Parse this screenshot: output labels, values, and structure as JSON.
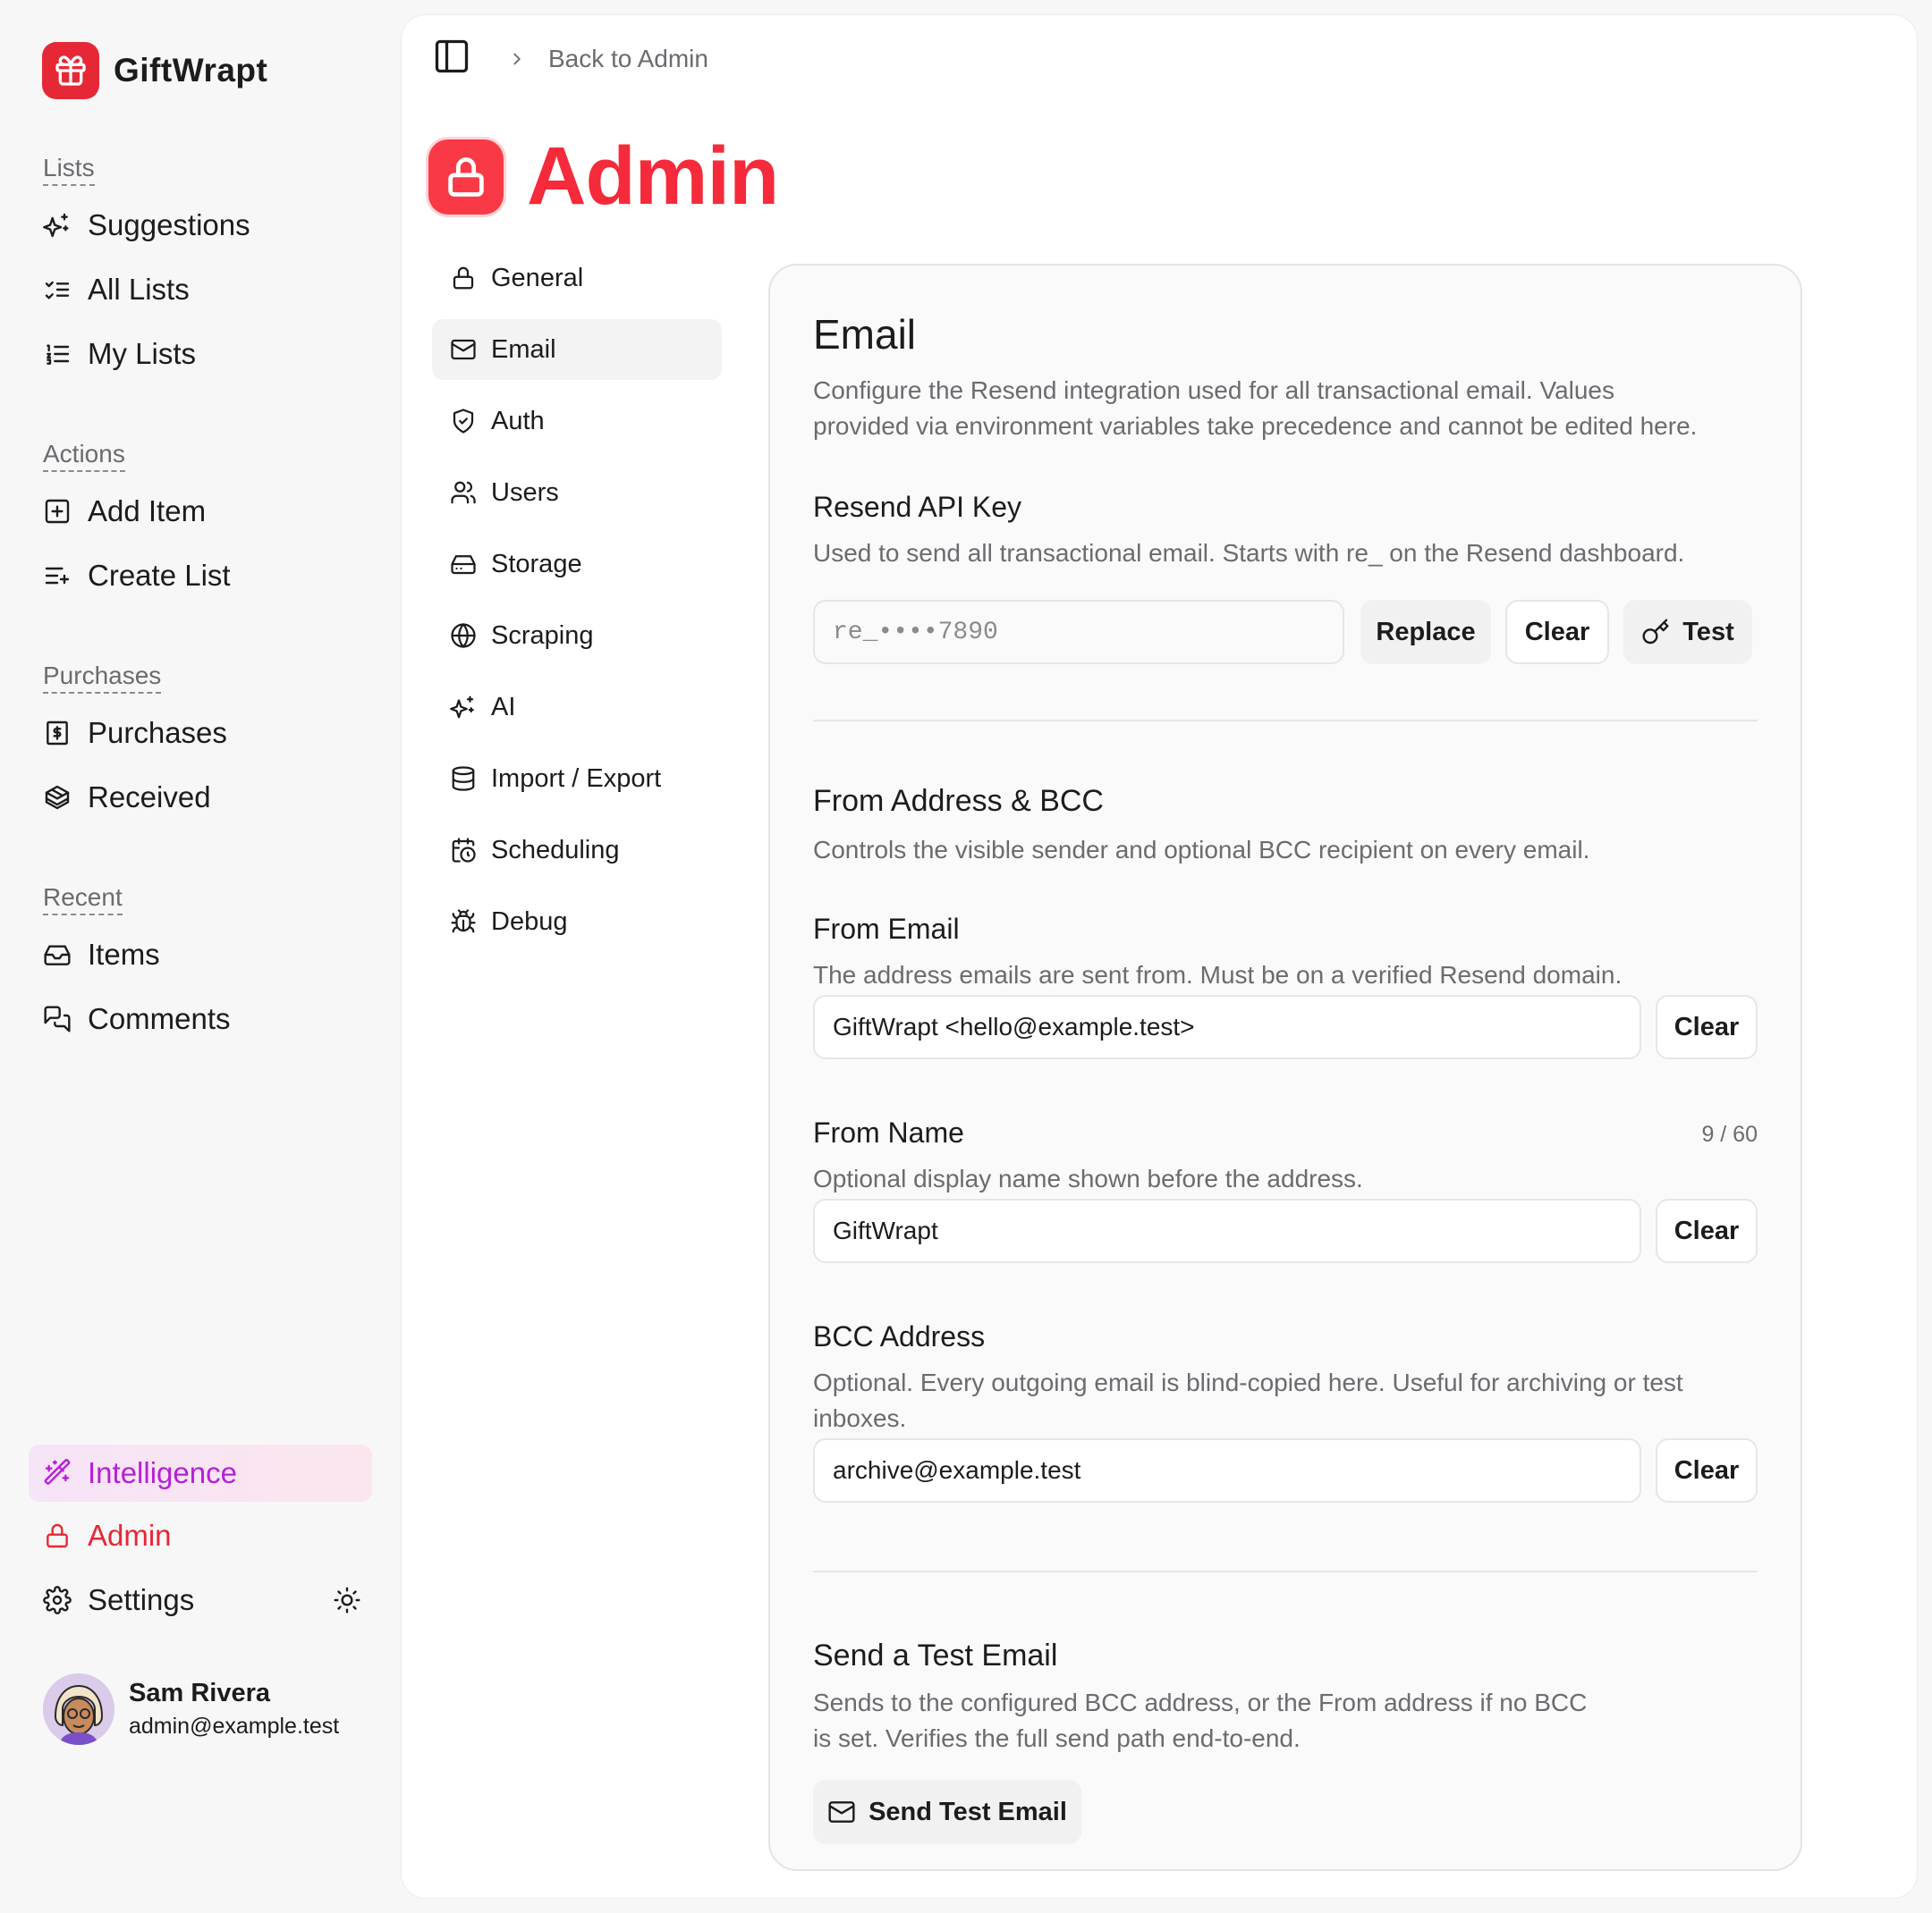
{
  "brand": {
    "name": "GiftWrapt",
    "accent": "#e62836"
  },
  "sidebar": {
    "sections": [
      {
        "title": "Lists",
        "items": [
          {
            "label": "Suggestions",
            "icon": "sparkles-icon"
          },
          {
            "label": "All Lists",
            "icon": "list-checks-icon"
          },
          {
            "label": "My Lists",
            "icon": "list-ordered-icon"
          }
        ]
      },
      {
        "title": "Actions",
        "items": [
          {
            "label": "Add Item",
            "icon": "plus-square-icon"
          },
          {
            "label": "Create List",
            "icon": "list-plus-icon"
          }
        ]
      },
      {
        "title": "Purchases",
        "items": [
          {
            "label": "Purchases",
            "icon": "receipt-icon"
          },
          {
            "label": "Received",
            "icon": "gift-box-icon"
          }
        ]
      },
      {
        "title": "Recent",
        "items": [
          {
            "label": "Items",
            "icon": "inbox-icon"
          },
          {
            "label": "Comments",
            "icon": "chat-icon"
          }
        ]
      }
    ],
    "intelligence": "Intelligence",
    "admin": "Admin",
    "settings": "Settings"
  },
  "user": {
    "name": "Sam Rivera",
    "email": "admin@example.test"
  },
  "breadcrumb": {
    "back": "Back to Admin"
  },
  "page": {
    "title": "Admin",
    "title_color": "#f52a3a"
  },
  "subnav": [
    {
      "label": "General",
      "icon": "lock-icon",
      "active": false
    },
    {
      "label": "Email",
      "icon": "mail-icon",
      "active": true
    },
    {
      "label": "Auth",
      "icon": "shield-icon",
      "active": false
    },
    {
      "label": "Users",
      "icon": "users-icon",
      "active": false
    },
    {
      "label": "Storage",
      "icon": "hard-drive-icon",
      "active": false
    },
    {
      "label": "Scraping",
      "icon": "globe-icon",
      "active": false
    },
    {
      "label": "AI",
      "icon": "sparkles-icon",
      "active": false
    },
    {
      "label": "Import / Export",
      "icon": "database-icon",
      "active": false
    },
    {
      "label": "Scheduling",
      "icon": "calendar-clock-icon",
      "active": false
    },
    {
      "label": "Debug",
      "icon": "bug-icon",
      "active": false
    }
  ],
  "email_card": {
    "title": "Email",
    "description_1": "Configure the Resend integration used for all transactional email. Values",
    "description_2": "provided via environment variables take precedence and cannot be edited here.",
    "api_key": {
      "label": "Resend API Key",
      "help": "Used to send all transactional email. Starts with re_ on the Resend dashboard.",
      "value": "re_••••7890",
      "replace": "Replace",
      "clear": "Clear",
      "test": "Test"
    },
    "from_section": {
      "title": "From Address & BCC",
      "description": "Controls the visible sender and optional BCC recipient on every email."
    },
    "from_email": {
      "label": "From Email",
      "help": "The address emails are sent from. Must be on a verified Resend domain.",
      "value": "GiftWrapt <hello@example.test>",
      "clear": "Clear"
    },
    "from_name": {
      "label": "From Name",
      "counter": "9 / 60",
      "help": "Optional display name shown before the address.",
      "value": "GiftWrapt",
      "clear": "Clear"
    },
    "bcc": {
      "label": "BCC Address",
      "help_1": "Optional. Every outgoing email is blind-copied here. Useful for archiving or test",
      "help_2": "inboxes.",
      "value": "archive@example.test",
      "clear": "Clear"
    },
    "test_email": {
      "title": "Send a Test Email",
      "description_1": "Sends to the configured BCC address, or the From address if no BCC",
      "description_2": "is set. Verifies the full send path end-to-end.",
      "button": "Send Test Email"
    }
  }
}
